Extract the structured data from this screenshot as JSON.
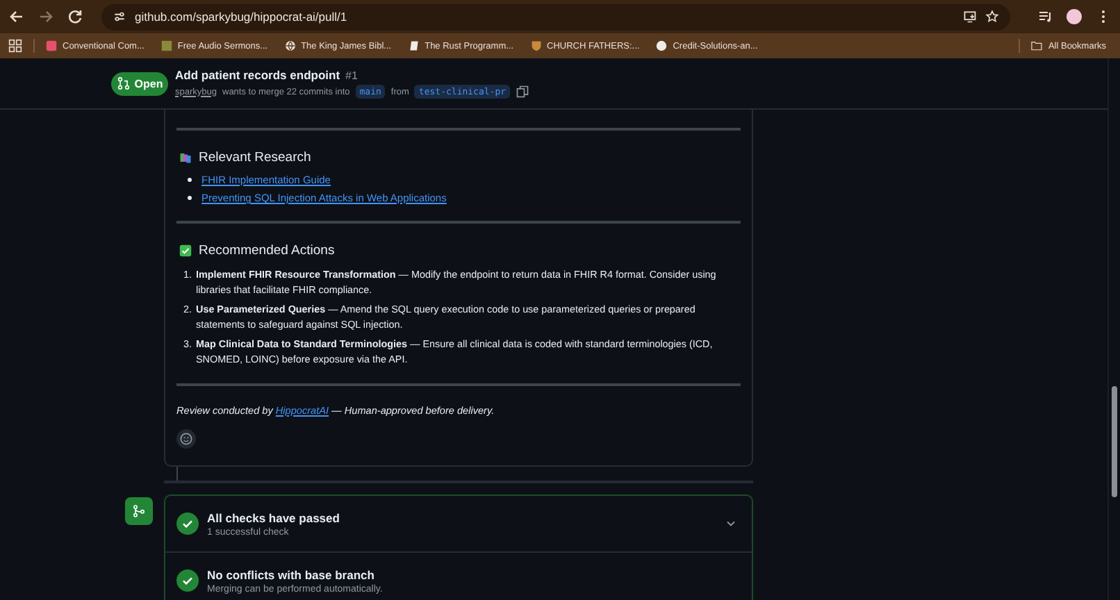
{
  "browser": {
    "url": "github.com/sparkybug/hippocrat-ai/pull/1",
    "back_enabled": true,
    "forward_enabled": false,
    "bookmarks": [
      {
        "label": "Conventional Com...",
        "kind": "pink-square"
      },
      {
        "label": "Free Audio Sermons...",
        "kind": "olive-square"
      },
      {
        "label": "The King James Bibl...",
        "kind": "globe"
      },
      {
        "label": "The Rust Programm...",
        "kind": "book"
      },
      {
        "label": "CHURCH FATHERS:...",
        "kind": "crest"
      },
      {
        "label": "Credit-Solutions-an...",
        "kind": "github"
      }
    ],
    "all_bookmarks": "All Bookmarks"
  },
  "pr": {
    "state": "Open",
    "title": "Add patient records endpoint",
    "number": "#1",
    "author": "sparkybug",
    "merge_text": "wants to merge 22 commits into",
    "base": "main",
    "from": "from",
    "head": "test-clinical-pr"
  },
  "comment": {
    "sections": [
      {
        "kind": "research",
        "heading": "Relevant Research",
        "links": [
          "FHIR Implementation Guide",
          "Preventing SQL Injection Attacks in Web Applications"
        ]
      },
      {
        "kind": "actions",
        "heading": "Recommended Actions",
        "items": [
          {
            "number": "1.",
            "text": "**Implement FHIR Resource Transformation** — Modify the endpoint to return data in FHIR R4 format. Consider using libraries that facilitate FHIR compliance."
          },
          {
            "number": "2.",
            "text": "**Use Parameterized Queries** — Amend the SQL query execution code to use parameterized queries or prepared statements to safeguard against SQL injection."
          },
          {
            "number": "3.",
            "text": "**Map Clinical Data to Standard Terminologies** — Ensure all clinical data is coded with standard terminologies (ICD, SNOMED, LOINC) before exposure via the API."
          }
        ]
      }
    ],
    "review_prefix": "Review conducted by",
    "review_link": "HippocratAI",
    "review_suffix": "— Human-approved before delivery."
  },
  "checks": [
    {
      "title": "All checks have passed",
      "subtitle": "1 successful check",
      "expandable": true
    },
    {
      "title": "No conflicts with base branch",
      "subtitle": "Merging can be performed automatically.",
      "expandable": false
    }
  ]
}
